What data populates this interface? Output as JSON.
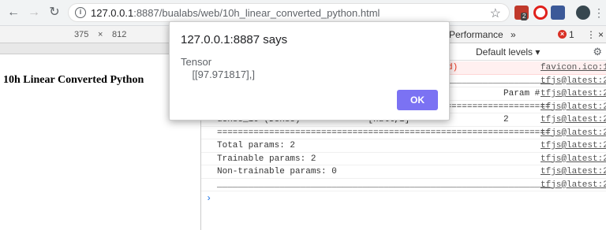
{
  "browser": {
    "url_host": "127.0.0.1",
    "url_rest": ":8887/bualabs/web/10h_linear_converted_python.html",
    "ext_badge": "2"
  },
  "device_toolbar": {
    "width": "375",
    "times": "×",
    "height": "812"
  },
  "page": {
    "heading": "10h Linear Converted Python"
  },
  "devtools": {
    "tab_performance": "Performance",
    "more_tabs": "»",
    "error_count": "1",
    "levels": "Default levels ▾",
    "console_rows": [
      {
        "msg": "",
        "src": "favicon.ico:1",
        "error": true,
        "tail": "d)"
      },
      {
        "msg": "________________________________________________________________",
        "src": "tfjs@latest:2"
      },
      {
        "msg": "Layer (type)                 Output shape              Param #",
        "src": "tfjs@latest:2"
      },
      {
        "msg": "================================================================",
        "src": "tfjs@latest:2"
      },
      {
        "msg": "dense_10 (Dense)             [null,1]                  2",
        "src": "tfjs@latest:2"
      },
      {
        "msg": "================================================================",
        "src": "tfjs@latest:2"
      },
      {
        "msg": "Total params: 2",
        "src": "tfjs@latest:2"
      },
      {
        "msg": "Trainable params: 2",
        "src": "tfjs@latest:2"
      },
      {
        "msg": "Non-trainable params: 0",
        "src": "tfjs@latest:2"
      },
      {
        "msg": "________________________________________________________________",
        "src": "tfjs@latest:2"
      }
    ],
    "prompt": "›"
  },
  "dialog": {
    "title": "127.0.0.1:8887 says",
    "body": "Tensor\n    [[97.971817],]",
    "ok": "OK"
  }
}
